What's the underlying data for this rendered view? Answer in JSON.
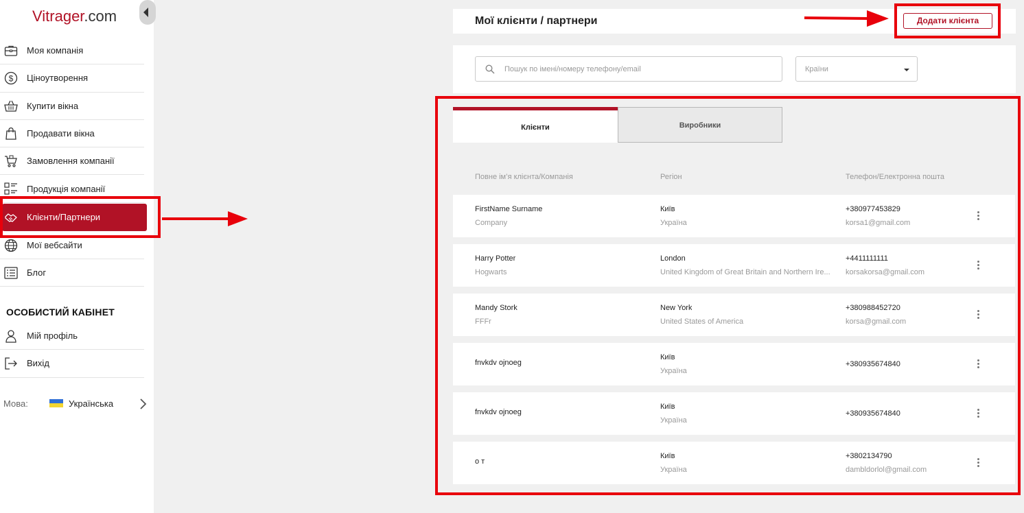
{
  "logo": {
    "brand": "Vitrager",
    "suffix": ".com"
  },
  "sidebar": {
    "items": [
      {
        "label": "Моя компанія",
        "icon": "briefcase-icon"
      },
      {
        "label": "Ціноутворення",
        "icon": "dollar-circle-icon"
      },
      {
        "label": "Купити вікна",
        "icon": "basket-icon"
      },
      {
        "label": "Продавати вікна",
        "icon": "shopping-bag-icon"
      },
      {
        "label": "Замовлення компанії",
        "icon": "cart-icon"
      },
      {
        "label": "Продукція компанії",
        "icon": "product-list-icon"
      },
      {
        "label": "Клієнти/Партнери",
        "icon": "handshake-icon",
        "active": true
      },
      {
        "label": "Мої вебсайти",
        "icon": "globe-icon"
      },
      {
        "label": "Блог",
        "icon": "blog-list-icon"
      }
    ],
    "section_title": "ОСОБИСТИЙ КАБІНЕТ",
    "personal": [
      {
        "label": "Мій профіль",
        "icon": "user-icon"
      },
      {
        "label": "Вихід",
        "icon": "logout-icon"
      }
    ],
    "language": {
      "label": "Мова:",
      "value": "Українська",
      "flag": "ukraine-flag-icon"
    }
  },
  "header": {
    "title": "Мої клієнти / партнери",
    "add_button": "Додати клієнта"
  },
  "filters": {
    "search_placeholder": "Пошук по імені/номеру телефону/email",
    "country_placeholder": "Країни"
  },
  "tabs": [
    {
      "label": "Клієнти",
      "active": true
    },
    {
      "label": "Виробники",
      "active": false
    }
  ],
  "table": {
    "columns": [
      "Повне ім’я клієнта/Компанія",
      "Регіон",
      "Телефон/Електронна пошта"
    ],
    "rows": [
      {
        "name": "FirstName Surname",
        "company": "Company",
        "city": "Київ",
        "country": "Україна",
        "phone": "+380977453829",
        "email": "korsa1@gmail.com"
      },
      {
        "name": "Harry Potter",
        "company": "Hogwarts",
        "city": "London",
        "country": "United Kingdom of Great Britain and Northern Ire...",
        "phone": "+4411111111",
        "email": "korsakorsa@gmail.com"
      },
      {
        "name": "Mandy Stork",
        "company": "FFFr",
        "city": "New York",
        "country": "United States of America",
        "phone": "+380988452720",
        "email": "korsa@gmail.com"
      },
      {
        "name": "fnvkdv ojnoeg",
        "company": "",
        "city": "Київ",
        "country": "Україна",
        "phone": "+380935674840",
        "email": ""
      },
      {
        "name": "fnvkdv ojnoeg",
        "company": "",
        "city": "Київ",
        "country": "Україна",
        "phone": "+380935674840",
        "email": ""
      },
      {
        "name": "о т",
        "company": "",
        "city": "Київ",
        "country": "Україна",
        "phone": "+3802134790",
        "email": "dambldorlol@gmail.com"
      }
    ]
  },
  "colors": {
    "accent": "#b11226",
    "annotation": "#e8000b",
    "background": "#f0f0f0"
  }
}
